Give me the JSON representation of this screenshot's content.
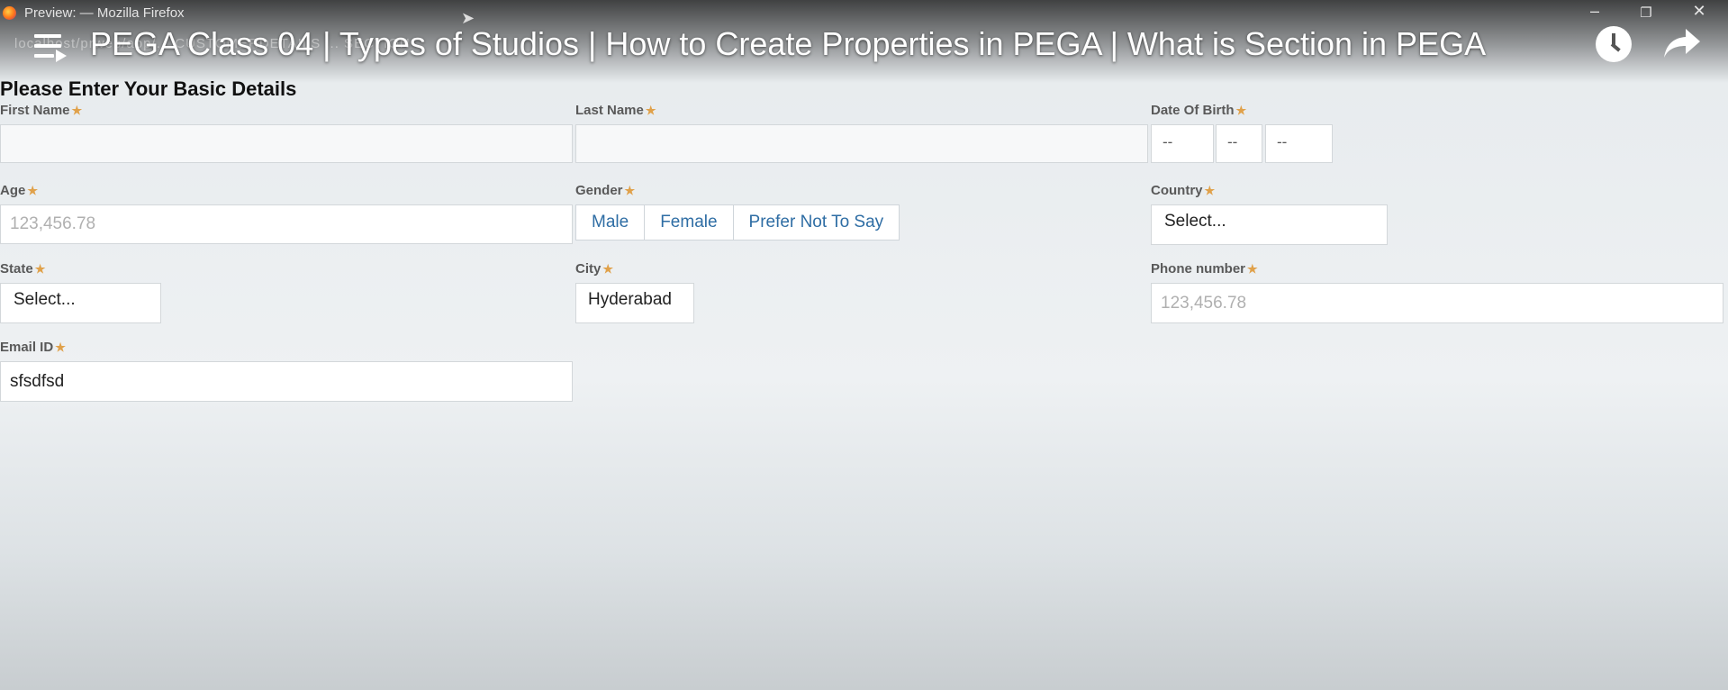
{
  "window": {
    "title": "Preview: — Mozilla Firefox",
    "url_ghost": "localhost/prweb/app/... CUSTOMERDETAILS ... SECTION",
    "controls": {
      "minimize": "–",
      "restore": "❐",
      "close": "✕"
    }
  },
  "video": {
    "title": "PEGA Class 04 | Types of Studios | How to Create Properties in PEGA | What is Section in PEGA",
    "icons": [
      "menu-icon",
      "clock-icon",
      "share-icon"
    ]
  },
  "form": {
    "heading": "Please Enter Your Basic Details",
    "required_marker": "★",
    "first_name": {
      "label": "First Name",
      "value": ""
    },
    "last_name": {
      "label": "Last Name",
      "value": ""
    },
    "dob": {
      "label": "Date Of Birth",
      "day": "--",
      "month": "--",
      "year": "--"
    },
    "age": {
      "label": "Age",
      "placeholder": "123,456.78"
    },
    "gender": {
      "label": "Gender",
      "options": [
        "Male",
        "Female",
        "Prefer Not To Say"
      ]
    },
    "country": {
      "label": "Country",
      "value": "Select..."
    },
    "state": {
      "label": "State",
      "value": "Select..."
    },
    "city": {
      "label": "City",
      "value": "Hyderabad"
    },
    "phone": {
      "label": "Phone number",
      "placeholder": "123,456.78"
    },
    "email": {
      "label": "Email ID",
      "value": "sfsdfsd"
    }
  },
  "colors": {
    "link": "#2e6da4",
    "required": "#e0a14a",
    "label": "#595959"
  }
}
